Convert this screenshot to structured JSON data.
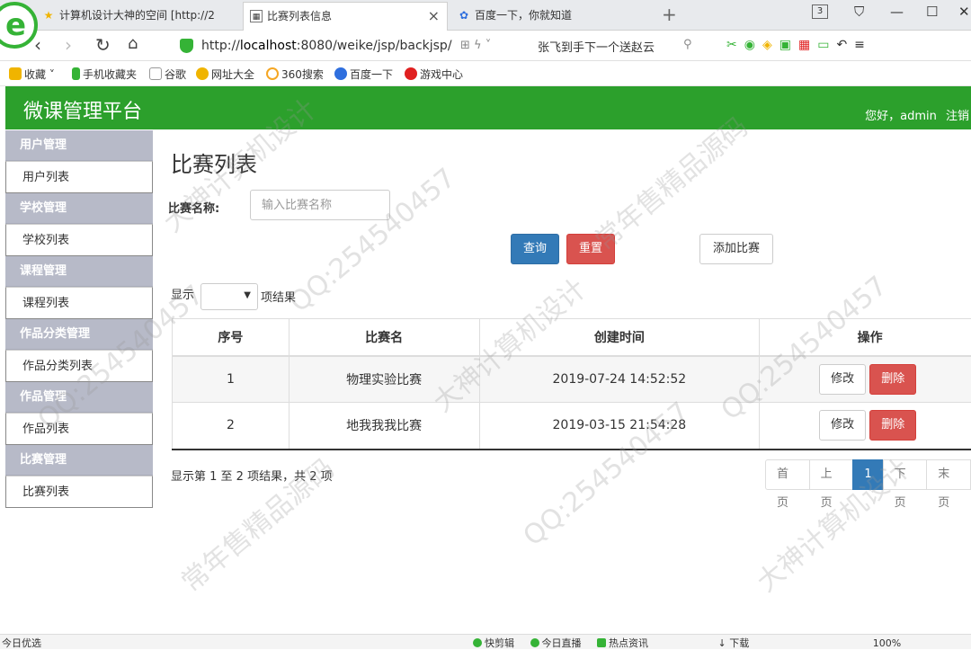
{
  "browser": {
    "tabs": [
      {
        "title": "计算机设计大神的空间 [http://2",
        "active": false
      },
      {
        "title": "比赛列表信息",
        "active": true
      },
      {
        "title": "百度一下，你就知道",
        "active": false
      }
    ],
    "tab_count": "3",
    "url_prefix": "http://",
    "url_host": "localhost",
    "url_rest": ":8080/weike/jsp/backjsp/",
    "search_hint": "张飞到手下一个送赵云",
    "bookmarks": [
      {
        "label": "收藏",
        "color": "#f0b400"
      },
      {
        "label": "手机收藏夹",
        "color": "#35b336"
      },
      {
        "label": "谷歌",
        "color": "#999999"
      },
      {
        "label": "网址大全",
        "color": "#f0b400"
      },
      {
        "label": "360搜索",
        "color": "#f5a623"
      },
      {
        "label": "百度一下",
        "color": "#2f6fde"
      },
      {
        "label": "游戏中心",
        "color": "#e02020"
      }
    ]
  },
  "app": {
    "title": "微课管理平台",
    "greeting": "您好，admin",
    "logout": "注销",
    "header_color": "#2ca02c"
  },
  "sidebar": {
    "groups": [
      {
        "title": "用户管理",
        "item": "用户列表"
      },
      {
        "title": "学校管理",
        "item": "学校列表"
      },
      {
        "title": "课程管理",
        "item": "课程列表"
      },
      {
        "title": "作品分类管理",
        "item": "作品分类列表"
      },
      {
        "title": "作品管理",
        "item": "作品列表"
      },
      {
        "title": "比赛管理",
        "item": "比赛列表"
      }
    ]
  },
  "main": {
    "page_title": "比赛列表",
    "filter_label": "比赛名称:",
    "filter_placeholder": "输入比赛名称",
    "query_button": "查询",
    "reset_button": "重置",
    "add_button": "添加比赛",
    "length_prefix": "显示",
    "length_suffix": "项结果",
    "columns": [
      "序号",
      "比赛名",
      "创建时间",
      "操作"
    ],
    "rows": [
      {
        "id": "1",
        "name": "物理实验比赛",
        "created": "2019-07-24 14:52:52"
      },
      {
        "id": "2",
        "name": "地我我我比赛",
        "created": "2019-03-15 21:54:28"
      }
    ],
    "edit_label": "修改",
    "delete_label": "删除",
    "info": "显示第 1 至 2 项结果，共 2 项",
    "pager": [
      "首页",
      "上页",
      "1",
      "下页",
      "末页"
    ]
  },
  "statusbar": {
    "left": "今日优选",
    "items": [
      "快剪辑",
      "今日直播",
      "热点资讯",
      "下载",
      "100%"
    ]
  },
  "watermarks": [
    "QQ:254540457",
    "大神计算机设计",
    "常年售精品源码"
  ]
}
